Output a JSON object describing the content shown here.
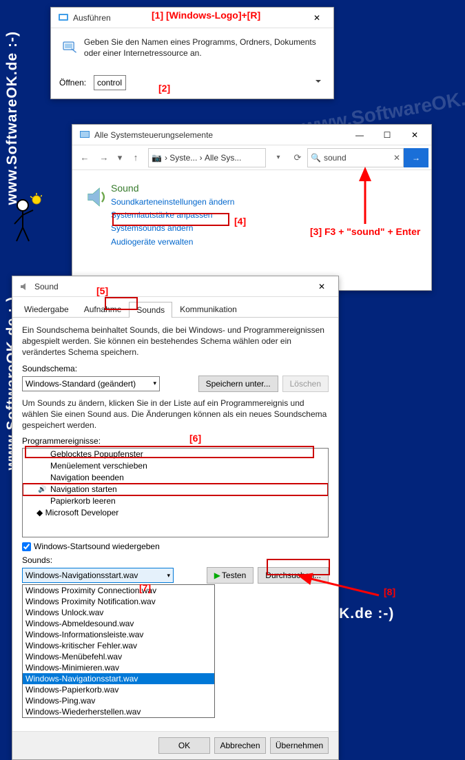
{
  "watermark": "www.SoftwareOK.de :-)",
  "annotations": {
    "a1": "[1] [Windows-Logo]+[R]",
    "a2": "[2]",
    "a3": "[3] F3 + \"sound\" + Enter",
    "a4": "[4]",
    "a5": "[5]",
    "a6": "[6]",
    "a7": "[7]",
    "a8": "[8]"
  },
  "run": {
    "title": "Ausführen",
    "description": "Geben Sie den Namen eines Programms, Ordners, Dokuments oder einer Internetressource an.",
    "open_label": "Öffnen:",
    "value": "control"
  },
  "cp": {
    "title": "Alle Systemsteuerungselemente",
    "breadcrumb_parts": [
      "Syste...",
      "Alle Sys..."
    ],
    "search_value": "sound",
    "heading": "Sound",
    "links": [
      "Soundkarteneinstellungen ändern",
      "Systemlautstärke anpassen",
      "Systemsounds ändern",
      "Audiogeräte verwalten"
    ]
  },
  "sound": {
    "title": "Sound",
    "tabs": [
      "Wiedergabe",
      "Aufnahme",
      "Sounds",
      "Kommunikation"
    ],
    "active_tab_index": 2,
    "info1": "Ein Soundschema beinhaltet Sounds, die bei Windows- und Programmereignissen abgespielt werden. Sie können ein bestehendes Schema wählen oder ein verändertes Schema speichern.",
    "scheme_label": "Soundschema:",
    "scheme_value": "Windows-Standard (geändert)",
    "save_as": "Speichern unter...",
    "delete": "Löschen",
    "info2": "Um Sounds zu ändern, klicken Sie in der Liste auf ein Programmereignis und wählen Sie einen Sound aus. Die Änderungen können als ein neues Soundschema gespeichert werden.",
    "events_label": "Programmereignisse:",
    "events": [
      {
        "label": "Geblocktes Popupfenster"
      },
      {
        "label": "Menüelement verschieben"
      },
      {
        "label": "Navigation beenden"
      },
      {
        "label": "Navigation starten",
        "selected": true,
        "icon": true
      },
      {
        "label": "Papierkorb leeren"
      }
    ],
    "dev_group": "Microsoft Developer",
    "startup_checkbox": "Windows-Startsound wiedergeben",
    "sounds_label": "Sounds:",
    "current_sound": "Windows-Navigationsstart.wav",
    "test": "Testen",
    "browse": "Durchsuchen...",
    "ok": "OK",
    "cancel": "Abbrechen",
    "apply": "Übernehmen",
    "dropdown_options": [
      "Windows Proximity Connection.wav",
      "Windows Proximity Notification.wav",
      "Windows Unlock.wav",
      "Windows-Abmeldesound.wav",
      "Windows-Informationsleiste.wav",
      "Windows-kritischer Fehler.wav",
      "Windows-Menübefehl.wav",
      "Windows-Minimieren.wav",
      "Windows-Navigationsstart.wav",
      "Windows-Papierkorb.wav",
      "Windows-Ping.wav",
      "Windows-Wiederherstellen.wav"
    ],
    "dropdown_selected_index": 8
  }
}
